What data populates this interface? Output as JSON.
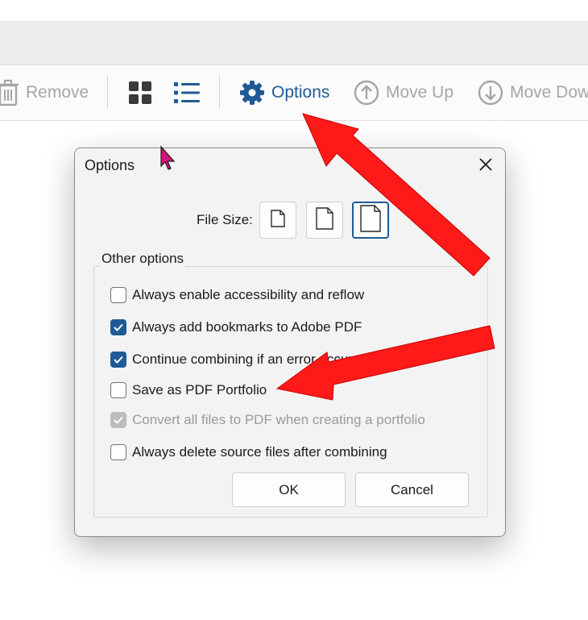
{
  "toolbar": {
    "remove_label": "Remove",
    "options_label": "Options",
    "move_up_label": "Move Up",
    "move_down_label": "Move Dow"
  },
  "dialog": {
    "title": "Options",
    "file_size_label": "File Size:",
    "group_label": "Other options",
    "options": [
      {
        "label": "Always enable accessibility and reflow",
        "state": "unchecked"
      },
      {
        "label": "Always add bookmarks to Adobe PDF",
        "state": "checked"
      },
      {
        "label": "Continue combining if an error occurs",
        "state": "checked"
      },
      {
        "label": "Save as PDF Portfolio",
        "state": "unchecked"
      },
      {
        "label": "Convert all files to PDF when creating a portfolio",
        "state": "checked-disabled"
      },
      {
        "label": "Always delete source files after combining",
        "state": "unchecked"
      }
    ],
    "ok_label": "OK",
    "cancel_label": "Cancel"
  },
  "colors": {
    "accent": "#1f5a96",
    "annotation_arrow": "#ff1a1a",
    "cursor": "#d4147a"
  },
  "icons": [
    "trash-icon",
    "grid-view-icon",
    "list-view-icon",
    "gear-icon",
    "arrow-up-circle-icon",
    "arrow-down-circle-icon",
    "close-icon",
    "small-page-icon",
    "medium-page-icon",
    "large-page-icon",
    "checkmark-icon",
    "mouse-cursor-icon"
  ]
}
